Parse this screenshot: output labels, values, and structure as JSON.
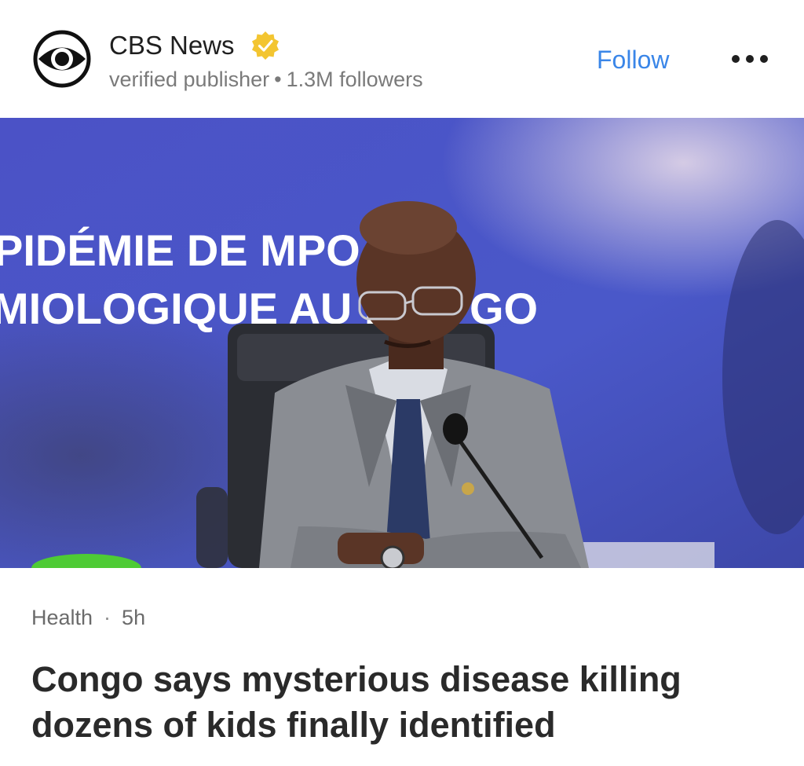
{
  "publisher": {
    "name": "CBS News",
    "verified_label": "verified publisher",
    "separator": "•",
    "followers": "1.3M followers",
    "logo_icon": "cbs-eye-icon",
    "badge_icon": "verified-badge-icon",
    "badge_color": "#f3c531"
  },
  "actions": {
    "follow_label": "Follow",
    "follow_color": "#3a86e8",
    "more_icon": "more-dots-icon"
  },
  "image": {
    "backdrop_text_line1": "PIDÉMIE DE MPO",
    "backdrop_text_line2": "MIOLOGIQUE AU K",
    "backdrop_text_tail": "GO",
    "backdrop_color": "#4a55c4"
  },
  "article": {
    "category": "Health",
    "separator": "·",
    "age": "5h",
    "headline": "Congo says mysterious disease killing dozens of kids finally identified"
  }
}
